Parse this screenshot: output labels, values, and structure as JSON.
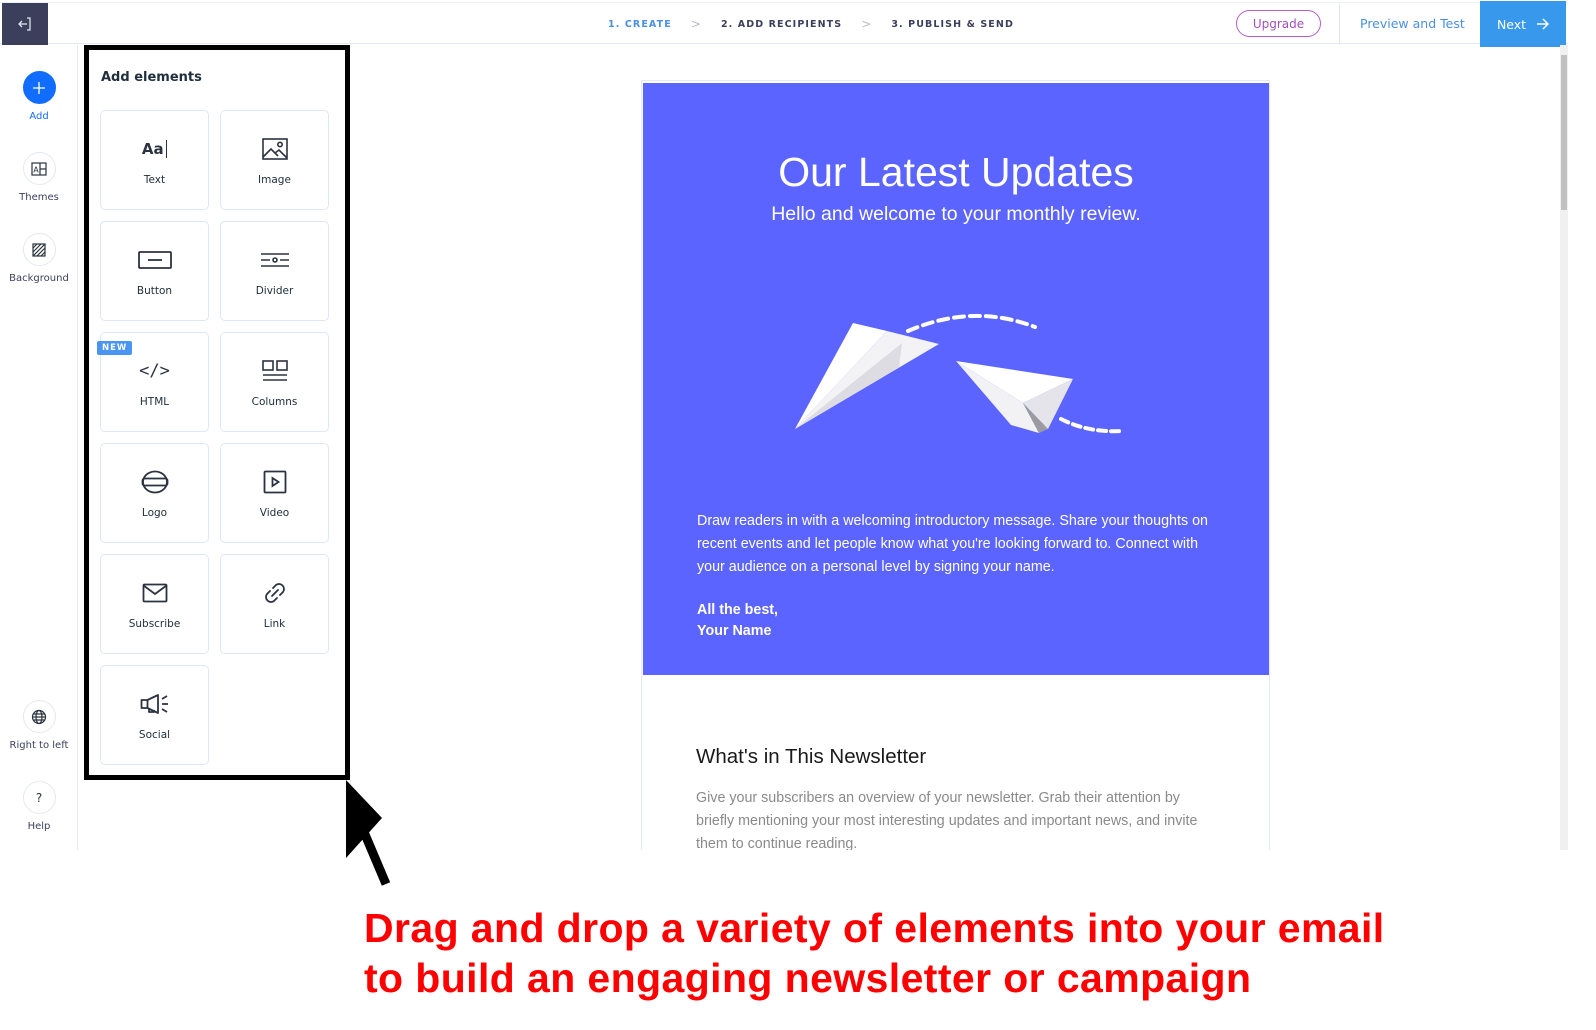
{
  "topbar": {
    "exit_icon": "exit-icon",
    "steps": [
      {
        "label": "1. CREATE",
        "active": true
      },
      {
        "label": "2. ADD RECIPIENTS",
        "active": false
      },
      {
        "label": "3. PUBLISH & SEND",
        "active": false
      }
    ],
    "step_separator": ">",
    "upgrade_label": "Upgrade",
    "preview_label": "Preview and Test",
    "next_label": "Next",
    "next_icon": "arrow-right-icon"
  },
  "rail": {
    "items": [
      {
        "label": "Add",
        "icon": "plus-icon",
        "active": true
      },
      {
        "label": "Themes",
        "icon": "themes-icon",
        "active": false
      },
      {
        "label": "Background",
        "icon": "background-icon",
        "active": false
      },
      {
        "label": "Right to left",
        "icon": "globe-icon",
        "active": false
      },
      {
        "label": "Help",
        "icon": "help-icon",
        "active": false
      }
    ]
  },
  "panel": {
    "title": "Add elements",
    "badge": "NEW",
    "tiles": [
      {
        "label": "Text",
        "icon": "text-icon",
        "icon_text": "Aa"
      },
      {
        "label": "Image",
        "icon": "image-icon"
      },
      {
        "label": "Button",
        "icon": "button-icon"
      },
      {
        "label": "Divider",
        "icon": "divider-icon"
      },
      {
        "label": "HTML",
        "icon": "code-icon",
        "icon_text": "</>",
        "new": true
      },
      {
        "label": "Columns",
        "icon": "columns-icon"
      },
      {
        "label": "Logo",
        "icon": "logo-icon"
      },
      {
        "label": "Video",
        "icon": "video-icon"
      },
      {
        "label": "Subscribe",
        "icon": "envelope-icon"
      },
      {
        "label": "Link",
        "icon": "link-icon"
      },
      {
        "label": "Social",
        "icon": "megaphone-icon"
      }
    ]
  },
  "email": {
    "hero_bg": "#5b64fe",
    "title": "Our Latest Updates",
    "subtitle": "Hello and welcome to your monthly review.",
    "body": "Draw readers in with a welcoming introductory message. Share your thoughts on recent events and let people know what you're looking forward to. Connect with your audience on a personal level by signing your name.",
    "sign_line1": "All the best,",
    "sign_line2": "Your Name",
    "section_title": "What's in This Newsletter",
    "section_body": "Give your subscribers an overview of your newsletter. Grab their attention by briefly mentioning your most interesting updates and important news, and invite them to continue reading."
  },
  "annotation": {
    "line1": "Drag and drop a variety of elements into your email",
    "line2": "to build an engaging newsletter or campaign",
    "color": "#ff0000"
  }
}
